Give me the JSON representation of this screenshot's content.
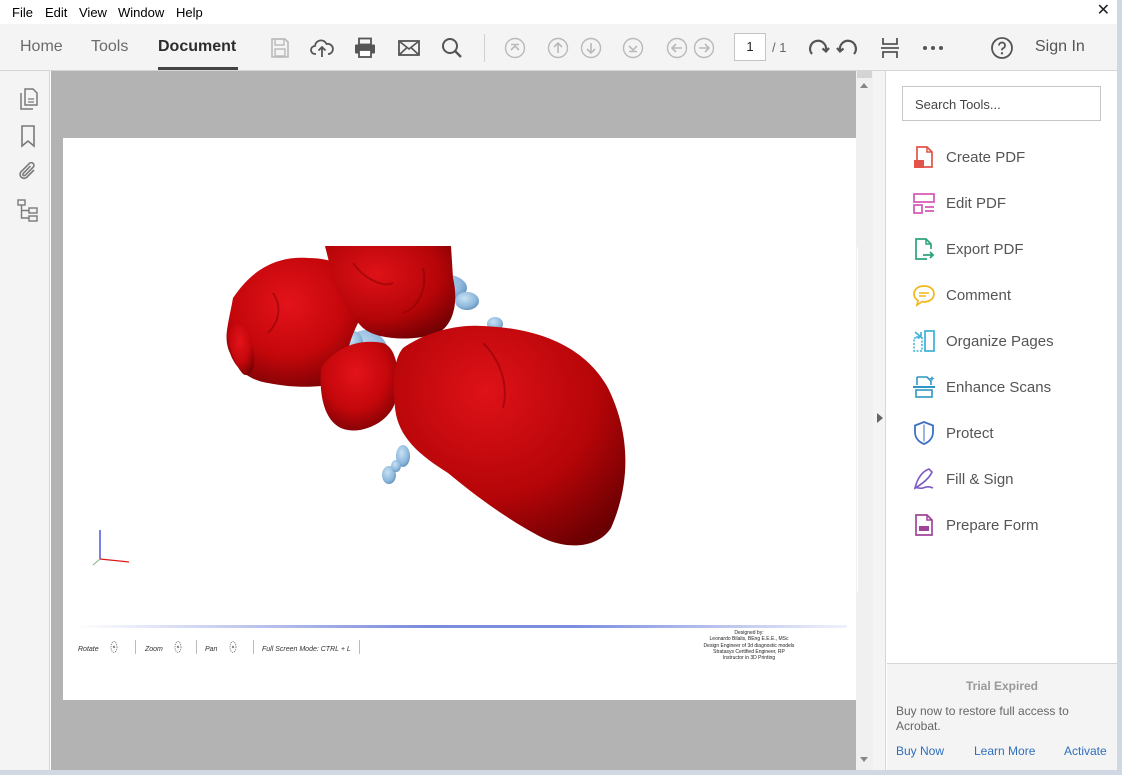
{
  "menu": [
    "File",
    "Edit",
    "View",
    "Window",
    "Help"
  ],
  "window": {
    "close_icon": "close-icon"
  },
  "toolbar": {
    "tabs": [
      "Home",
      "Tools",
      "Document"
    ],
    "active_tab": "Document",
    "page_current": "1",
    "page_total": "/ 1",
    "sign_in": "Sign In",
    "icons": [
      "save-icon",
      "upload-icon",
      "print-icon",
      "email-icon",
      "search-icon",
      "first-page-icon",
      "prev-page-icon",
      "next-page-icon",
      "last-page-icon",
      "back-icon",
      "forward-icon",
      "rotate-cw-icon",
      "rotate-ccw-icon",
      "scroll-mode-icon",
      "more-icon",
      "help-icon"
    ]
  },
  "left_rail": {
    "icons": [
      "pages-icon",
      "bookmark-icon",
      "attachment-icon",
      "structure-icon"
    ]
  },
  "document": {
    "controls": [
      "Rotate",
      "Zoom",
      "Pan",
      "Full Screen Mode:  CTRL + L"
    ],
    "credits": [
      "Designed by:",
      "Leonardo Bilalis, BEng E.E.E., MSc",
      "Design Engineer of 3d diagnostic models",
      "Stratasys Certified Engineer, RP",
      "Instructor in 3D Printing"
    ],
    "model_colors": {
      "tissue": "#c4070b",
      "vessel": "#8cb7dc"
    }
  },
  "right_panel": {
    "search_placeholder": "Search Tools...",
    "tools": [
      {
        "label": "Create PDF",
        "icon": "create-pdf-icon",
        "color": "#e2544a"
      },
      {
        "label": "Edit PDF",
        "icon": "edit-pdf-icon",
        "color": "#d655b6"
      },
      {
        "label": "Export PDF",
        "icon": "export-pdf-icon",
        "color": "#2ba37b"
      },
      {
        "label": "Comment",
        "icon": "comment-icon",
        "color": "#f2b619"
      },
      {
        "label": "Organize Pages",
        "icon": "organize-pages-icon",
        "color": "#3ab1d8"
      },
      {
        "label": "Enhance Scans",
        "icon": "enhance-scans-icon",
        "color": "#2e97c4"
      },
      {
        "label": "Protect",
        "icon": "protect-icon",
        "color": "#3d6fc4"
      },
      {
        "label": "Fill & Sign",
        "icon": "fill-sign-icon",
        "color": "#7c5ac8"
      },
      {
        "label": "Prepare Form",
        "icon": "prepare-form-icon",
        "color": "#a0449a"
      }
    ],
    "trial": {
      "title": "Trial Expired",
      "message": "Buy now to restore full access to Acrobat.",
      "links": [
        "Buy Now",
        "Learn More",
        "Activate"
      ]
    }
  }
}
